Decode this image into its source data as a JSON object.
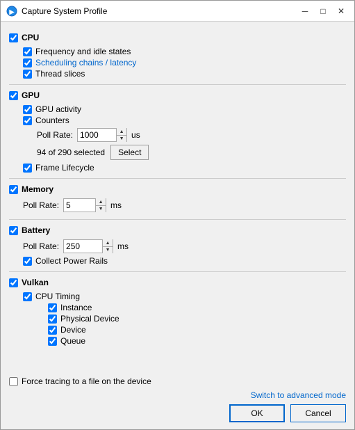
{
  "window": {
    "title": "Capture System Profile",
    "icon": "●",
    "minimize_label": "─",
    "maximize_label": "□",
    "close_label": "✕"
  },
  "sections": {
    "cpu": {
      "label": "CPU",
      "checked": true,
      "items": [
        {
          "id": "freq",
          "label": "Frequency and idle states",
          "checked": true,
          "blue": false
        },
        {
          "id": "sched",
          "label": "Scheduling chains / latency",
          "checked": true,
          "blue": true
        },
        {
          "id": "thread",
          "label": "Thread slices",
          "checked": true,
          "blue": false
        }
      ]
    },
    "gpu": {
      "label": "GPU",
      "checked": true,
      "activity": {
        "label": "GPU activity",
        "checked": true
      },
      "counters": {
        "label": "Counters",
        "checked": true
      },
      "poll_rate": {
        "label": "Poll Rate:",
        "value": "1000",
        "unit": "us"
      },
      "select_info": "94 of 290 selected",
      "select_btn": "Select",
      "frame_lifecycle": {
        "label": "Frame Lifecycle",
        "checked": true
      }
    },
    "memory": {
      "label": "Memory",
      "checked": true,
      "poll_rate": {
        "label": "Poll Rate:",
        "value": "5",
        "unit": "ms"
      }
    },
    "battery": {
      "label": "Battery",
      "checked": true,
      "poll_rate": {
        "label": "Poll Rate:",
        "value": "250",
        "unit": "ms"
      },
      "collect_power": {
        "label": "Collect Power Rails",
        "checked": true
      }
    },
    "vulkan": {
      "label": "Vulkan",
      "checked": true,
      "cpu_timing": {
        "label": "CPU Timing",
        "checked": true,
        "items": [
          {
            "id": "instance",
            "label": "Instance",
            "checked": true
          },
          {
            "id": "physical",
            "label": "Physical Device",
            "checked": true
          },
          {
            "id": "device",
            "label": "Device",
            "checked": true
          },
          {
            "id": "queue",
            "label": "Queue",
            "checked": true
          }
        ]
      }
    }
  },
  "footer": {
    "force_tracing": {
      "label": "Force tracing to a file on the device",
      "checked": false
    },
    "advanced_link": "Switch to advanced mode",
    "ok_label": "OK",
    "cancel_label": "Cancel"
  }
}
